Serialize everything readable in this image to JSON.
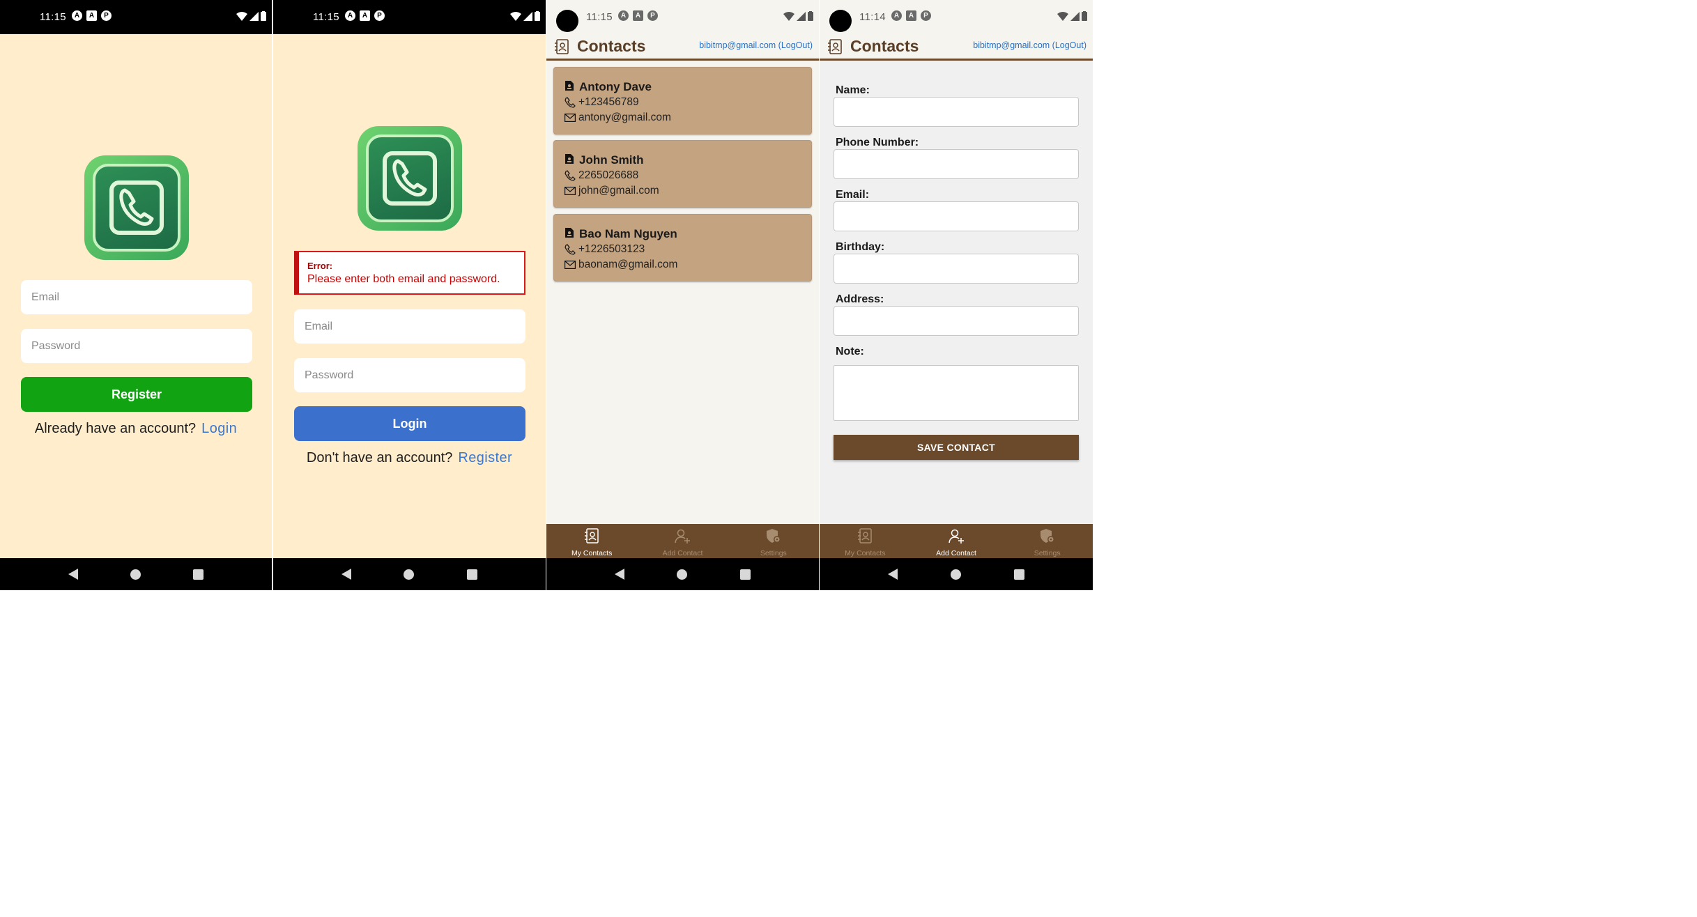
{
  "status": {
    "time_s1": "11:15",
    "time_s2": "11:15",
    "time_s3": "11:15",
    "time_s4": "11:14"
  },
  "register_screen": {
    "email_placeholder": "Email",
    "password_placeholder": "Password",
    "register_button": "Register",
    "prompt": "Already have an account?",
    "login_link": "Login"
  },
  "login_screen": {
    "error_title": "Error:",
    "error_message": "Please enter both email and password.",
    "email_placeholder": "Email",
    "password_placeholder": "Password",
    "login_button": "Login",
    "prompt": "Don't have an account?",
    "register_link": "Register"
  },
  "contacts_app": {
    "title": "Contacts",
    "user": "bibitmp@gmail.com (LogOut)",
    "contacts": [
      {
        "name": "Antony Dave",
        "phone": "+123456789",
        "email": "antony@gmail.com"
      },
      {
        "name": "John Smith",
        "phone": "2265026688",
        "email": "john@gmail.com"
      },
      {
        "name": "Bao Nam Nguyen",
        "phone": "+1226503123",
        "email": "baonam@gmail.com"
      }
    ],
    "tabs": [
      "My Contacts",
      "Add Contact",
      "Settings"
    ]
  },
  "add_contact_form": {
    "labels": [
      "Name:",
      "Phone Number:",
      "Email:",
      "Birthday:",
      "Address:",
      "Note:"
    ],
    "save_button": "SAVE CONTACT"
  },
  "colors": {
    "auth_background": "#ffedcc",
    "register_button": "#12a312",
    "login_button": "#3b70cc",
    "link": "#3a78d0",
    "header_brown": "#6b4a2b",
    "card": "#c4a381",
    "error": "#c80000"
  },
  "icons": [
    "wifi-icon",
    "signal-icon",
    "battery-icon",
    "phone-icon",
    "contacts-book-icon",
    "add-person-icon",
    "shield-settings-icon",
    "person-badge-icon",
    "mail-icon"
  ]
}
